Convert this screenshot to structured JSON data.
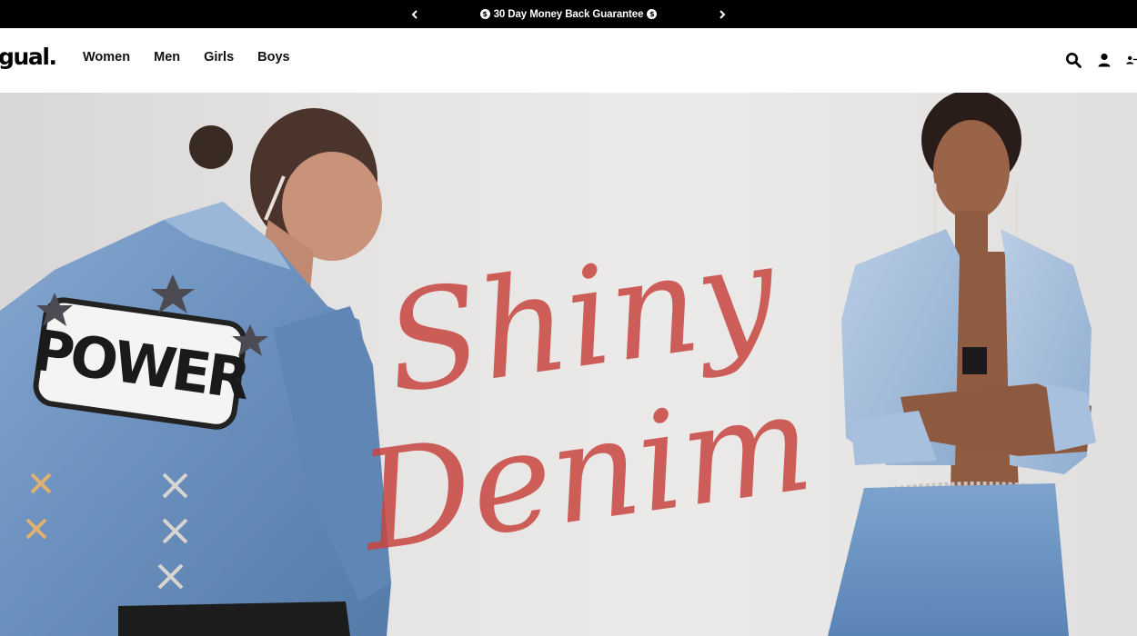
{
  "announcement": {
    "prev_icon": "chevron-left-icon",
    "next_icon": "chevron-right-icon",
    "text": "30 Day Money Back Guarantee",
    "badge_glyph": "$"
  },
  "header": {
    "logo": "gual.",
    "nav": [
      {
        "label": "Women"
      },
      {
        "label": "Men"
      },
      {
        "label": "Girls"
      },
      {
        "label": "Boys"
      }
    ],
    "icons": [
      "search-icon",
      "account-icon",
      "account-alt-icon"
    ]
  },
  "hero": {
    "headline_line1": "Shiny",
    "headline_line2": "Denim",
    "jacket_patch": "POWER",
    "headline_color": "#c8453f",
    "denim_color": "#6e95c4"
  }
}
